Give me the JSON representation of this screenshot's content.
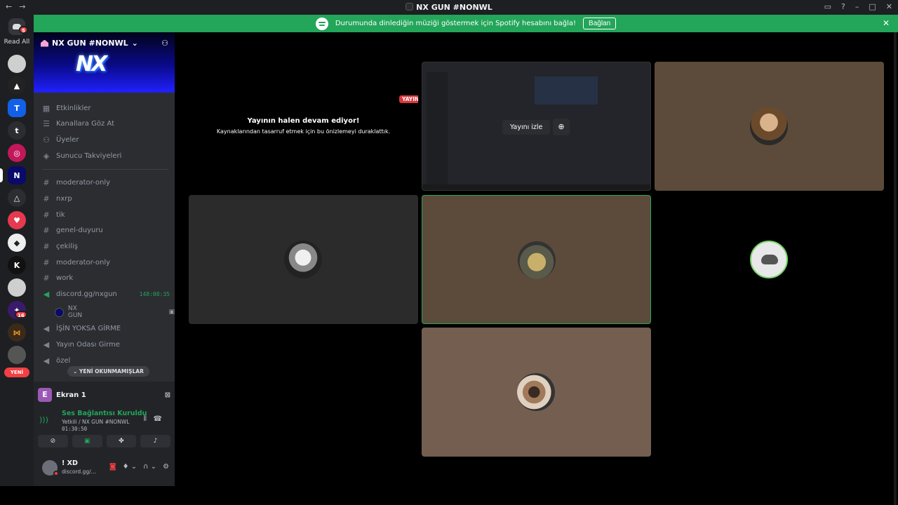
{
  "window": {
    "title": "NX GUN #NONWL",
    "nav_back": "←",
    "nav_forward": "→"
  },
  "banner": {
    "text": "Durumunda dinlediğin müziği göstermek için Spotify hesabını bağla!",
    "button": "Bağlan"
  },
  "rail": {
    "home_badge": "5",
    "read_all": "Read All",
    "badge_16": "16",
    "yeni": "YENİ"
  },
  "server": {
    "name": "NX GUN #NONWL",
    "logo_text": "NX"
  },
  "menu": [
    {
      "icon": "calendar-icon",
      "label": "Etkinlikler"
    },
    {
      "icon": "browse-icon",
      "label": "Kanallara Göz At"
    },
    {
      "icon": "members-icon",
      "label": "Üyeler"
    },
    {
      "icon": "boost-icon",
      "label": "Sunucu Takviyeleri"
    }
  ],
  "channels": [
    {
      "type": "text",
      "label": "moderator-only"
    },
    {
      "type": "text",
      "label": "nxrp"
    },
    {
      "type": "text",
      "label": "tik"
    },
    {
      "type": "text",
      "label": "genel-duyuru"
    },
    {
      "type": "text",
      "label": "çekiliş"
    },
    {
      "type": "text",
      "label": "moderator-only"
    },
    {
      "type": "text",
      "label": "work"
    },
    {
      "type": "voice",
      "label": "discord.gg/nxgun",
      "timer": "148:08:35"
    },
    {
      "type": "voice",
      "label": "İŞİN YOKSA GİRME"
    },
    {
      "type": "voice",
      "label": "Yayın Odası Girme"
    },
    {
      "type": "voice",
      "label": "özel"
    }
  ],
  "voice_user": "NX GUN",
  "unread_pill": "YENİ OKUNMAMIŞLAR",
  "voice_panel": {
    "screen_avatar": "E",
    "screen_name": "Ekran 1",
    "status": "Ses Bağlantısı Kuruldu",
    "location": "Yetkili / NX GUN #NONWL",
    "elapsed": "01:30:50"
  },
  "user": {
    "name": "! XD",
    "sub": "discord.gg/..."
  },
  "stage": {
    "live_tag": "YAYINDA",
    "paused_title": "Yayının halen devam ediyor!",
    "paused_sub": "Kaynaklarından tasarruf etmek için bu önizlemeyi duraklattık.",
    "watch": "Yayını izle"
  },
  "colors": {
    "green": "#23a55a",
    "red": "#f23f43",
    "sidebar": "#2b2d31",
    "rail": "#1e1f22"
  }
}
